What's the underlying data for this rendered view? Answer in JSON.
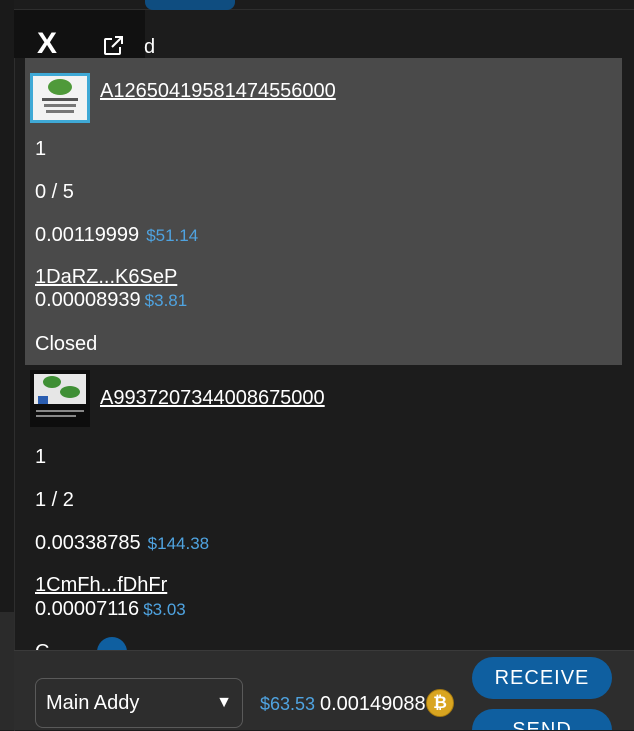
{
  "header": {
    "close_label": "X",
    "title_fragment": "d",
    "external_icon": "external-link-icon"
  },
  "items": [
    {
      "id": "A12650419581474556000",
      "qty": "1",
      "fill": "0 / 5",
      "price_btc": "0.00119999",
      "price_usd": "$51.14",
      "address": "1DaRZ...K6SeP",
      "sub_btc": "0.00008939",
      "sub_usd": "$3.81",
      "status": "Closed"
    },
    {
      "id": "A9937207344008675000",
      "qty": "1",
      "fill": "1 / 2",
      "price_btc": "0.00338785",
      "price_usd": "$144.38",
      "address": "1CmFh...fDhFr",
      "sub_btc": "0.00007116",
      "sub_usd": "$3.03",
      "status": "C"
    }
  ],
  "footer": {
    "wallet_select": "Main Addy",
    "balance_usd": "$63.53",
    "balance_btc": "0.00149088",
    "coin_icon": "bitcoin-icon",
    "receive_label": "RECEIVE",
    "send_label": "SEND"
  },
  "colors": {
    "accent": "#0f5fa0",
    "usd": "#4fa3e0",
    "selected_card": "#4a4a4a"
  }
}
